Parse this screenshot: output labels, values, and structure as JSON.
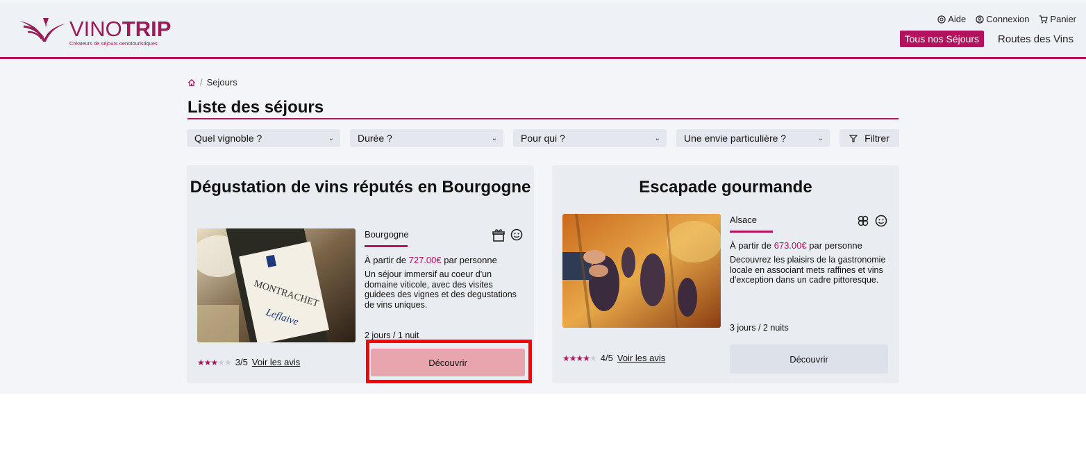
{
  "header": {
    "logo_text_thin": "VINO",
    "logo_text_bold": "TRIP",
    "logo_tagline": "Créateurs de séjours oenotouristiques",
    "top_links": [
      {
        "label": "Aide",
        "icon": "help-icon"
      },
      {
        "label": "Connexion",
        "icon": "user-icon"
      },
      {
        "label": "Panier",
        "icon": "cart-icon"
      }
    ],
    "nav": {
      "active": "Tous nos Séjours",
      "other": "Routes des Vins"
    }
  },
  "breadcrumb": {
    "home_icon": "home-icon",
    "current": "Sejours"
  },
  "page_title": "Liste des séjours",
  "filters": {
    "vineyard": "Quel vignoble ?",
    "duration": "Durée ?",
    "for_whom": "Pour qui ?",
    "wish": "Une envie particulière ?",
    "filter_button": "Filtrer"
  },
  "cards": [
    {
      "title": "Dégustation de vins réputés en Bourgogne",
      "region": "Bourgogne",
      "price_prefix": "À partir de",
      "price": "727.00€",
      "price_suffix": "par personne",
      "description": "Un séjour immersif au coeur d'un domaine viticole, avec des visites guidees des vignes et des degustations de vins uniques.",
      "duration": "2 jours / 1 nuit",
      "rating_stars": 3,
      "rating_text": "3/5",
      "reviews_link": "Voir les avis",
      "button": "Découvrir",
      "icons": [
        "gift-icon",
        "smile-icon"
      ],
      "highlighted": true
    },
    {
      "title": "Escapade gourmande",
      "region": "Alsace",
      "price_prefix": "À partir de",
      "price": "673.00€",
      "price_suffix": "par personne",
      "description": "Decouvrez les plaisirs de la gastronomie locale en associant mets raffines et vins d'exception dans un cadre pittoresque.",
      "duration": "3 jours / 2 nuits",
      "rating_stars": 4,
      "rating_text": "4/5",
      "reviews_link": "Voir les avis",
      "button": "Découvrir",
      "icons": [
        "flower-icon",
        "smile-icon"
      ],
      "highlighted": false
    }
  ],
  "colors": {
    "brand": "#b3125f",
    "highlight_border": "#ff0000"
  }
}
